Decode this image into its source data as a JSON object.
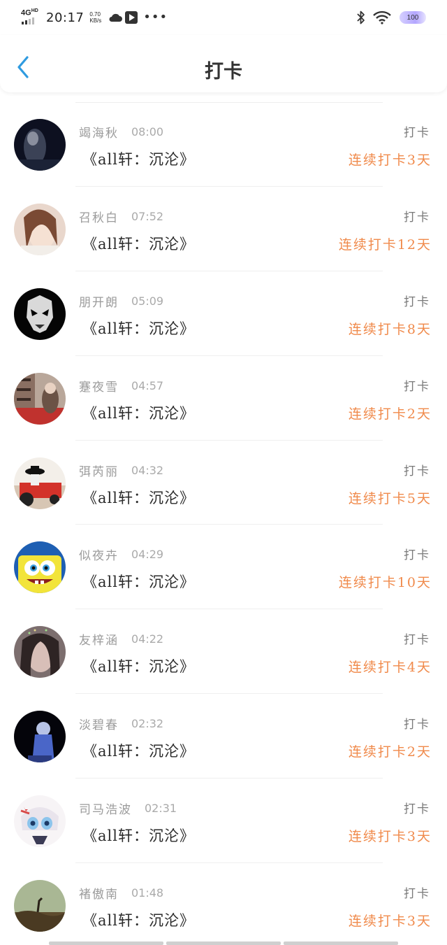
{
  "status_bar": {
    "network": "4G",
    "network_sup": "HD",
    "time": "20:17",
    "speed_value": "0.70",
    "speed_unit": "KB/s",
    "more": "•••",
    "battery": "100"
  },
  "header": {
    "title": "打卡",
    "back_icon": "chevron-left-icon"
  },
  "colors": {
    "accent_back": "#2f9be0",
    "streak": "#f08a4b",
    "name_gray": "#9b9b9b"
  },
  "checkins": [
    {
      "name": "竭海秋",
      "time": "08:00",
      "book": "《all轩：沉沦》",
      "action": "打卡",
      "streak": "连续打卡3天",
      "avatar": "dark-portrait"
    },
    {
      "name": "召秋白",
      "time": "07:52",
      "book": "《all轩：沉沦》",
      "action": "打卡",
      "streak": "连续打卡12天",
      "avatar": "girl-selfie"
    },
    {
      "name": "朋开朗",
      "time": "05:09",
      "book": "《all轩：沉沦》",
      "action": "打卡",
      "streak": "连续打卡8天",
      "avatar": "skull-mask"
    },
    {
      "name": "蹇夜雪",
      "time": "04:57",
      "book": "《all轩：沉沦》",
      "action": "打卡",
      "streak": "连续打卡2天",
      "avatar": "street-photo"
    },
    {
      "name": "弭芮丽",
      "time": "04:32",
      "book": "《all轩：沉沦》",
      "action": "打卡",
      "streak": "连续打卡5天",
      "avatar": "cowboy-tractor"
    },
    {
      "name": "似夜卉",
      "time": "04:29",
      "book": "《all轩：沉沦》",
      "action": "打卡",
      "streak": "连续打卡10天",
      "avatar": "spongebob"
    },
    {
      "name": "友梓涵",
      "time": "04:22",
      "book": "《all轩：沉沦》",
      "action": "打卡",
      "streak": "连续打卡4天",
      "avatar": "blurry-girl"
    },
    {
      "name": "淡碧春",
      "time": "02:32",
      "book": "《all轩：沉沦》",
      "action": "打卡",
      "streak": "连续打卡2天",
      "avatar": "stage-performer"
    },
    {
      "name": "司马浩波",
      "time": "02:31",
      "book": "《all轩：沉沦》",
      "action": "打卡",
      "streak": "连续打卡3天",
      "avatar": "anime-girl"
    },
    {
      "name": "褚傲南",
      "time": "01:48",
      "book": "《all轩：沉沦》",
      "action": "打卡",
      "streak": "连续打卡3天",
      "avatar": "green-landscape"
    }
  ]
}
